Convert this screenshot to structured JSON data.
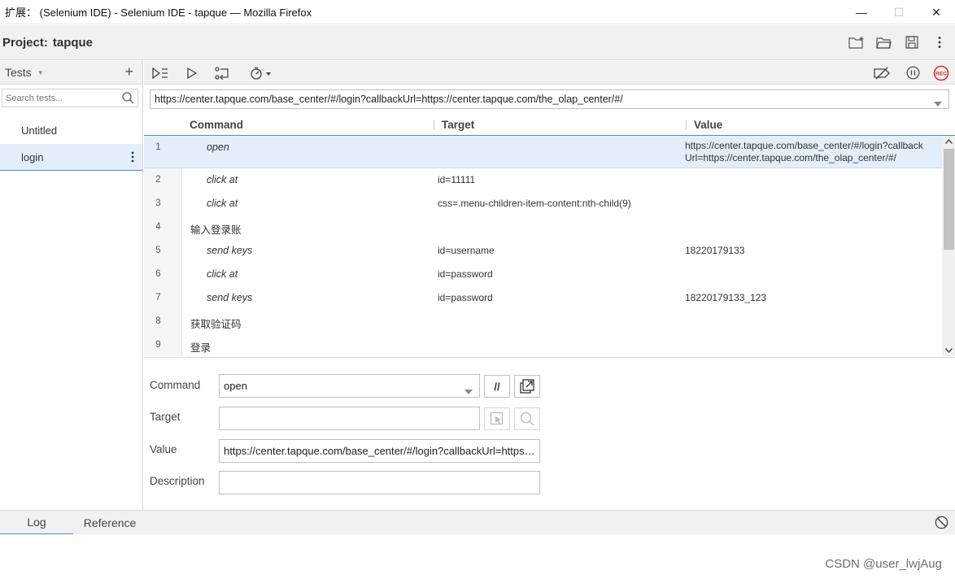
{
  "window": {
    "title": "扩展： (Selenium IDE) - Selenium IDE - tapque — Mozilla Firefox",
    "controls": {
      "minimize": "—",
      "maximize": "☐",
      "close": "✕"
    }
  },
  "project": {
    "label": "Project:",
    "name": "tapque"
  },
  "sidebar": {
    "header": "Tests",
    "search_placeholder": "Search tests...",
    "tests": [
      {
        "name": "Untitled",
        "active": false
      },
      {
        "name": "login",
        "active": true
      }
    ]
  },
  "toolbar": {
    "icons": [
      "run-all-icon",
      "run-icon",
      "step-icon",
      "speed-icon",
      "disable-breakpoints-icon",
      "pause-icon",
      "record-icon"
    ],
    "record_label": "REC",
    "accent": "#4a8cd6",
    "record_color": "#d93025"
  },
  "base_url": "https://center.tapque.com/base_center/#/login?callbackUrl=https://center.tapque.com/the_olap_center/#/",
  "table": {
    "headers": {
      "command": "Command",
      "target": "Target",
      "value": "Value"
    },
    "rows": [
      {
        "num": "1",
        "command": "open",
        "target": "",
        "value": "https://center.tapque.com/base_center/#/login?callbackUrl=https://center.tapque.com/the_olap_center/#/",
        "comment": false,
        "selected": true
      },
      {
        "num": "2",
        "command": "click at",
        "target": "id=11111",
        "value": "",
        "comment": false,
        "selected": false
      },
      {
        "num": "3",
        "command": "click at",
        "target": "css=.menu-children-item-content:nth-child(9)",
        "value": "",
        "comment": false,
        "selected": false
      },
      {
        "num": "4",
        "command": "输入登录账",
        "target": "",
        "value": "",
        "comment": true,
        "selected": false
      },
      {
        "num": "5",
        "command": "send keys",
        "target": "id=username",
        "value": "18220179133",
        "comment": false,
        "selected": false
      },
      {
        "num": "6",
        "command": "click at",
        "target": "id=password",
        "value": "",
        "comment": false,
        "selected": false
      },
      {
        "num": "7",
        "command": "send keys",
        "target": "id=password",
        "value": "18220179133_123",
        "comment": false,
        "selected": false
      },
      {
        "num": "8",
        "command": "获取验证码",
        "target": "",
        "value": "",
        "comment": true,
        "selected": false
      },
      {
        "num": "9",
        "command": "登录",
        "target": "",
        "value": "",
        "comment": true,
        "selected": false
      }
    ]
  },
  "editor": {
    "command_label": "Command",
    "command_value": "open",
    "comment_toggle": "//",
    "target_label": "Target",
    "target_value": "",
    "value_label": "Value",
    "value_value": "https://center.tapque.com/base_center/#/login?callbackUrl=https://center.tapque.com/the_olap_center/#/",
    "description_label": "Description",
    "description_value": ""
  },
  "bottom": {
    "tabs": [
      {
        "label": "Log",
        "active": true
      },
      {
        "label": "Reference",
        "active": false
      }
    ]
  },
  "watermark": "CSDN @user_lwjAug"
}
